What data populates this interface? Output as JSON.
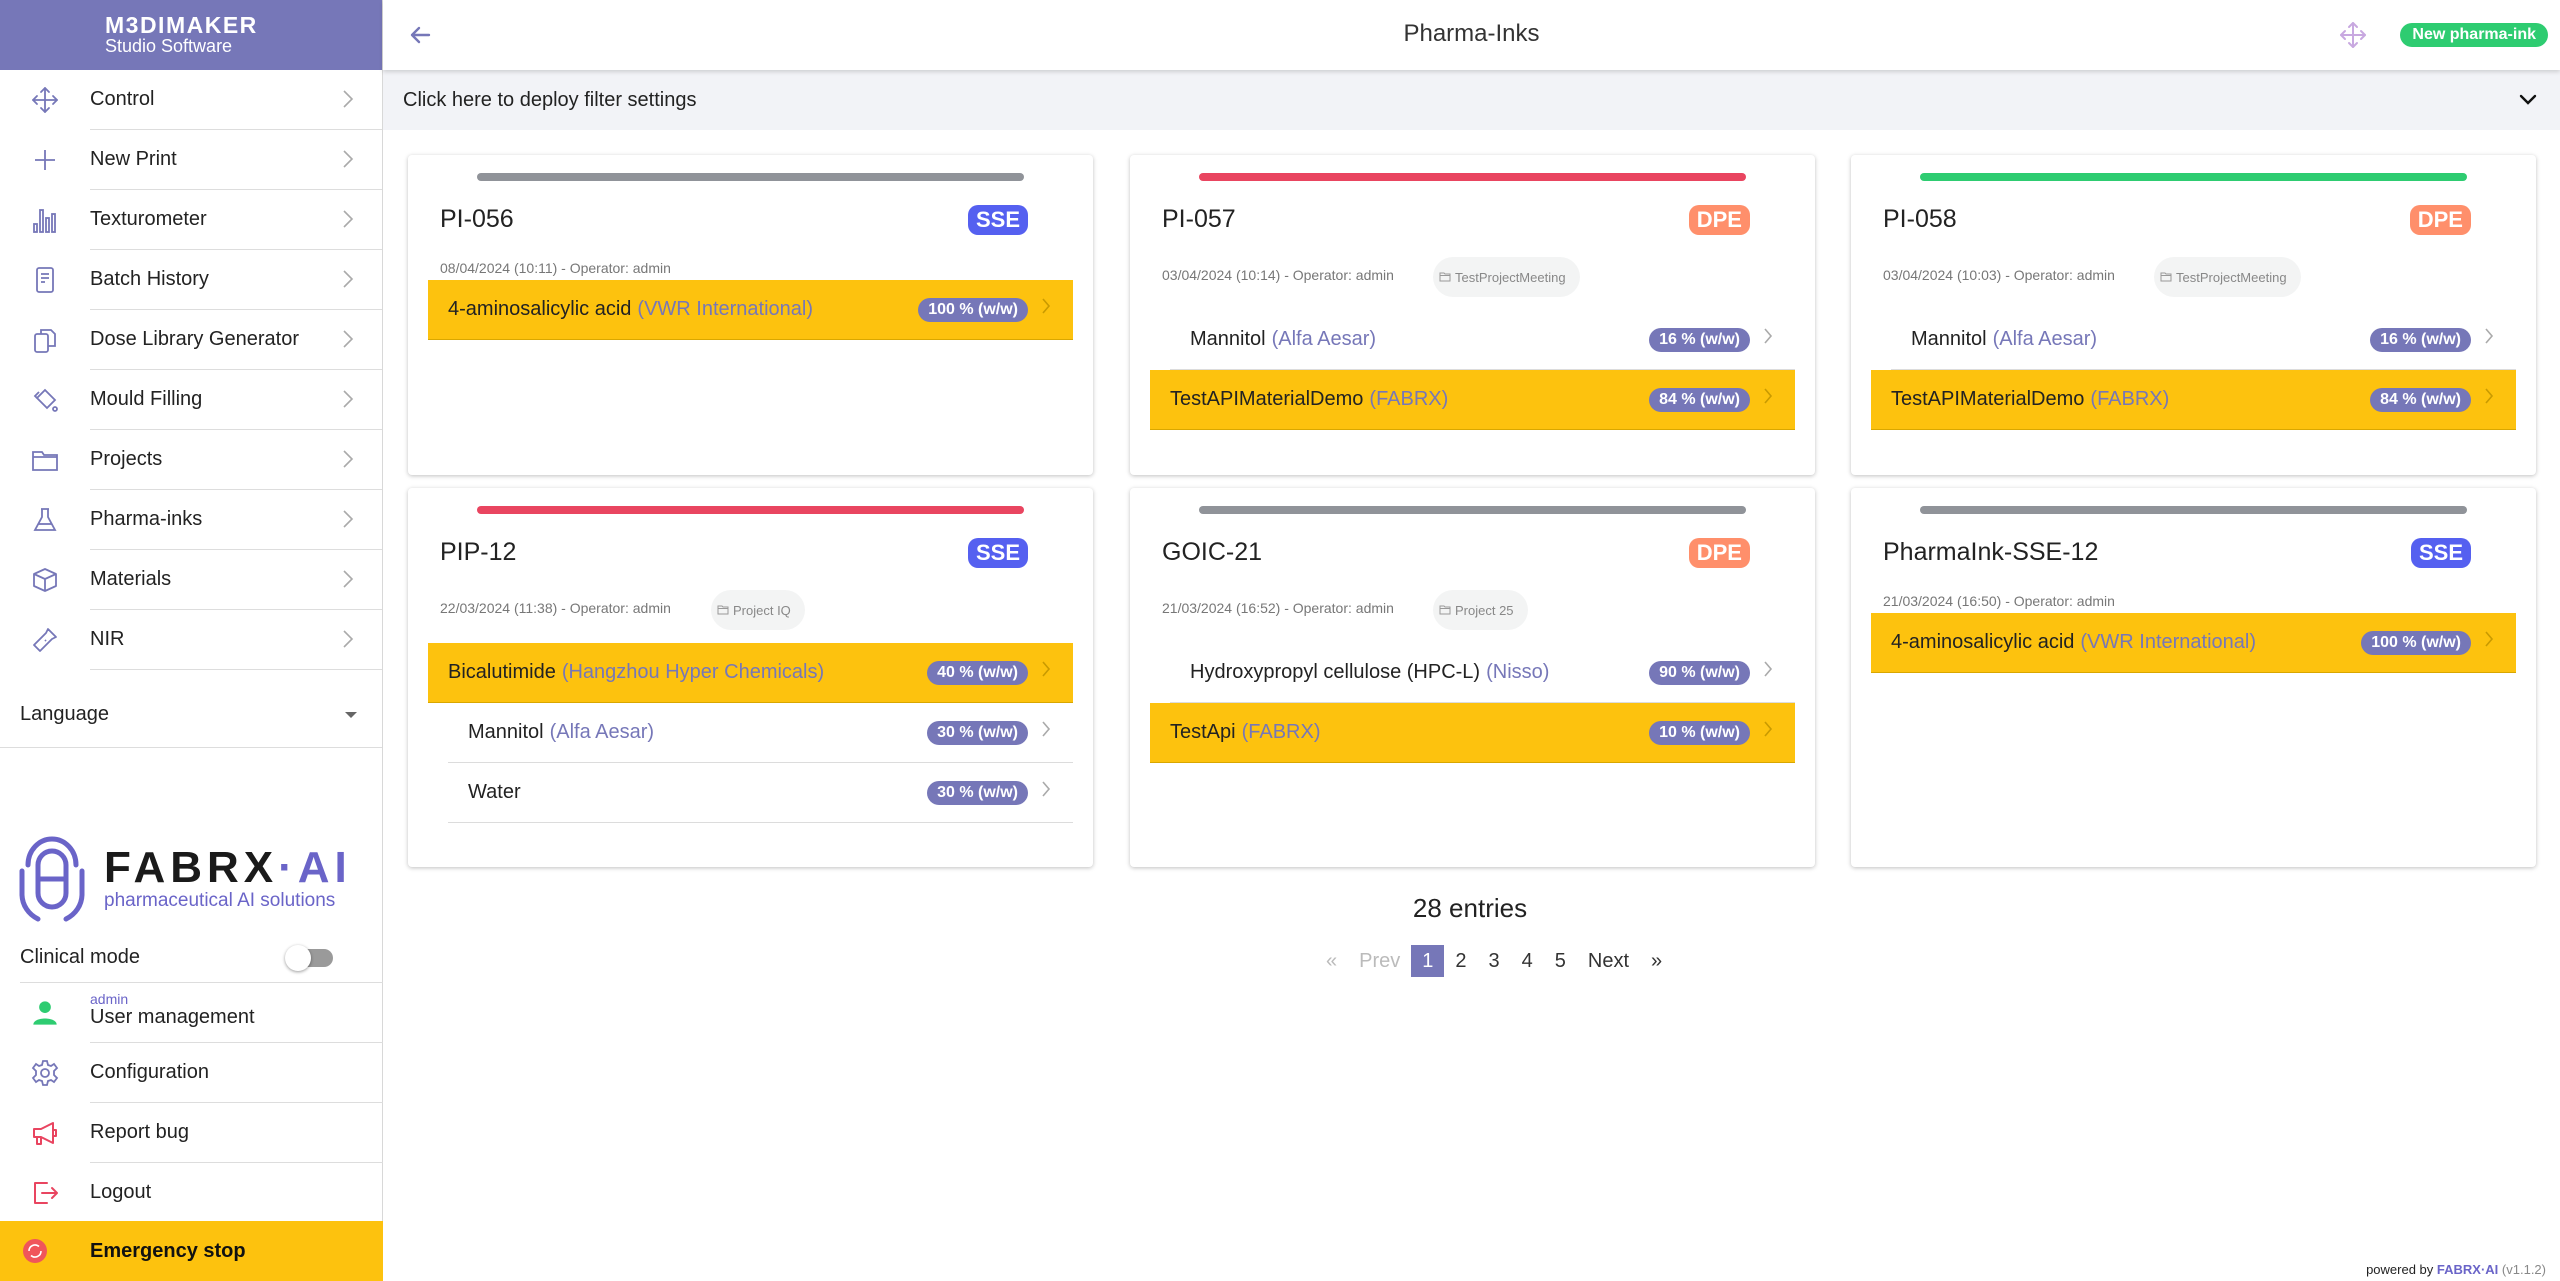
{
  "app": {
    "brand_line1": "M3DIMAKER",
    "brand_line2": "Studio Software"
  },
  "sidebar": {
    "items": [
      {
        "label": "Control",
        "icon": "move-arrows-icon"
      },
      {
        "label": "New Print",
        "icon": "plus-icon"
      },
      {
        "label": "Texturometer",
        "icon": "bar-chart-icon"
      },
      {
        "label": "Batch History",
        "icon": "document-icon"
      },
      {
        "label": "Dose Library Generator",
        "icon": "copy-files-icon"
      },
      {
        "label": "Mould Filling",
        "icon": "paint-bucket-icon"
      },
      {
        "label": "Projects",
        "icon": "folder-icon"
      },
      {
        "label": "Pharma-inks",
        "icon": "flask-icon"
      },
      {
        "label": "Materials",
        "icon": "cube-icon"
      },
      {
        "label": "NIR",
        "icon": "flashlight-icon"
      }
    ],
    "language_label": "Language",
    "logo_word": "FABRX",
    "logo_suffix": "AI",
    "logo_tagline": "pharmaceutical AI solutions",
    "clinical_mode_label": "Clinical mode",
    "clinical_mode_on": false,
    "user": {
      "role": "admin",
      "label": "User management"
    },
    "bottom_items": [
      {
        "label": "Configuration",
        "icon": "gear-icon"
      },
      {
        "label": "Report bug",
        "icon": "megaphone-icon"
      },
      {
        "label": "Logout",
        "icon": "logout-icon"
      }
    ],
    "emergency_label": "Emergency stop"
  },
  "header": {
    "title": "Pharma-Inks",
    "new_button": "New pharma-ink"
  },
  "filter": {
    "label": "Click here to deploy filter settings"
  },
  "colors": {
    "accent": "#7677b8",
    "highlight": "#fdc20e",
    "sse": "#5560f0",
    "dpe": "#ff8f6b",
    "status_gray": "#909399",
    "status_red": "#e94560",
    "status_green": "#2ecc71",
    "new_button": "#2ecc71"
  },
  "cards": [
    {
      "name": "PI-056",
      "type": "SSE",
      "status": "gray",
      "meta": "08/04/2024 (10:11) - Operator: admin",
      "project": null,
      "ingredients": [
        {
          "name": "4-aminosalicylic acid",
          "supplier": "(VWR International)",
          "pct": "100 % (w/w)",
          "highlight": true
        }
      ]
    },
    {
      "name": "PI-057",
      "type": "DPE",
      "status": "red",
      "meta": "03/04/2024 (10:14) - Operator: admin",
      "project": "TestProjectMeeting",
      "ingredients": [
        {
          "name": "Mannitol",
          "supplier": "(Alfa Aesar)",
          "pct": "16 % (w/w)",
          "highlight": false
        },
        {
          "name": "TestAPIMaterialDemo",
          "supplier": "(FABRX)",
          "pct": "84 % (w/w)",
          "highlight": true
        }
      ]
    },
    {
      "name": "PI-058",
      "type": "DPE",
      "status": "green",
      "meta": "03/04/2024 (10:03) - Operator: admin",
      "project": "TestProjectMeeting",
      "ingredients": [
        {
          "name": "Mannitol",
          "supplier": "(Alfa Aesar)",
          "pct": "16 % (w/w)",
          "highlight": false
        },
        {
          "name": "TestAPIMaterialDemo",
          "supplier": "(FABRX)",
          "pct": "84 % (w/w)",
          "highlight": true
        }
      ]
    },
    {
      "name": "PIP-12",
      "type": "SSE",
      "status": "red",
      "meta": "22/03/2024 (11:38) - Operator: admin",
      "project": "Project IQ",
      "ingredients": [
        {
          "name": "Bicalutimide",
          "supplier": "(Hangzhou Hyper Chemicals)",
          "pct": "40 % (w/w)",
          "highlight": true
        },
        {
          "name": "Mannitol",
          "supplier": "(Alfa Aesar)",
          "pct": "30 % (w/w)",
          "highlight": false
        },
        {
          "name": "Water",
          "supplier": "",
          "pct": "30 % (w/w)",
          "highlight": false
        }
      ]
    },
    {
      "name": "GOIC-21",
      "type": "DPE",
      "status": "gray",
      "meta": "21/03/2024 (16:52) - Operator: admin",
      "project": "Project 25",
      "ingredients": [
        {
          "name": "Hydroxypropyl cellulose (HPC-L)",
          "supplier": "(Nisso)",
          "pct": "90 % (w/w)",
          "highlight": false
        },
        {
          "name": "TestApi",
          "supplier": "(FABRX)",
          "pct": "10 % (w/w)",
          "highlight": true
        }
      ]
    },
    {
      "name": "PharmaInk-SSE-12",
      "type": "SSE",
      "status": "gray",
      "meta": "21/03/2024 (16:50) - Operator: admin",
      "project": null,
      "ingredients": [
        {
          "name": "4-aminosalicylic acid",
          "supplier": "(VWR International)",
          "pct": "100 % (w/w)",
          "highlight": true
        }
      ]
    }
  ],
  "pagination": {
    "entries": "28 entries",
    "first": "«",
    "prev": "Prev",
    "pages": [
      "1",
      "2",
      "3",
      "4",
      "5"
    ],
    "current": "1",
    "next": "Next",
    "last": "»"
  },
  "footer": {
    "powered_by": "powered by",
    "brand": "FABRX·AI",
    "version": "(v1.1.2)"
  }
}
